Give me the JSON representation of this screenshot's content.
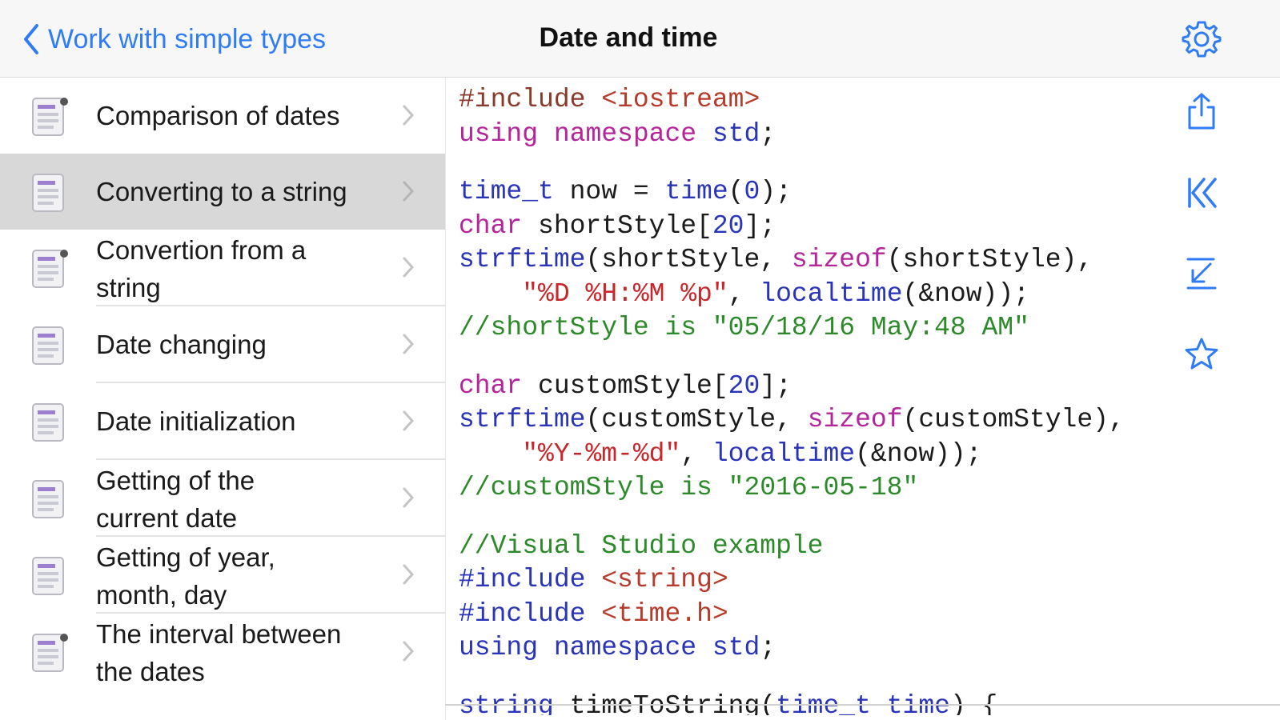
{
  "navbar": {
    "back_label": "Work with simple types",
    "title": "Date and time"
  },
  "list": {
    "items": [
      {
        "label": "Comparison of dates",
        "selected": false,
        "locked": true
      },
      {
        "label": "Converting to a string",
        "selected": true,
        "locked": false
      },
      {
        "label": "Convertion from a string",
        "selected": false,
        "locked": true
      },
      {
        "label": "Date changing",
        "selected": false,
        "locked": false
      },
      {
        "label": "Date initialization",
        "selected": false,
        "locked": false
      },
      {
        "label": "Getting of the current date",
        "selected": false,
        "locked": false
      },
      {
        "label": "Getting of year, month, day",
        "selected": false,
        "locked": false
      },
      {
        "label": "The interval between the dates",
        "selected": false,
        "locked": true
      }
    ]
  },
  "code_lines": [
    "#include <iostream>",
    "using namespace std;",
    "",
    "time_t now = time(0);",
    "char shortStyle[20];",
    "strftime(shortStyle, sizeof(shortStyle),",
    "    \"%D %H:%M %p\", localtime(&now));",
    "//shortStyle is \"05/18/16 May:48 AM\"",
    "",
    "char customStyle[20];",
    "strftime(customStyle, sizeof(customStyle),",
    "    \"%Y-%m-%d\", localtime(&now));",
    "//customStyle is \"2016-05-18\"",
    "",
    "//Visual Studio example",
    "#include <string>",
    "#include <time.h>",
    "using namespace std;",
    "",
    "string timeToString(time_t time) {"
  ],
  "toolbar": {
    "icons": [
      "share-icon",
      "first-page-icon",
      "download-icon",
      "favorite-star-icon"
    ]
  },
  "colors": {
    "accent": "#2f7cf6",
    "selected_row": "#d8d8d8",
    "keyword": "#b5249b",
    "type": "#2a34b8",
    "comment": "#2d8a2a",
    "string": "#c8262a"
  }
}
